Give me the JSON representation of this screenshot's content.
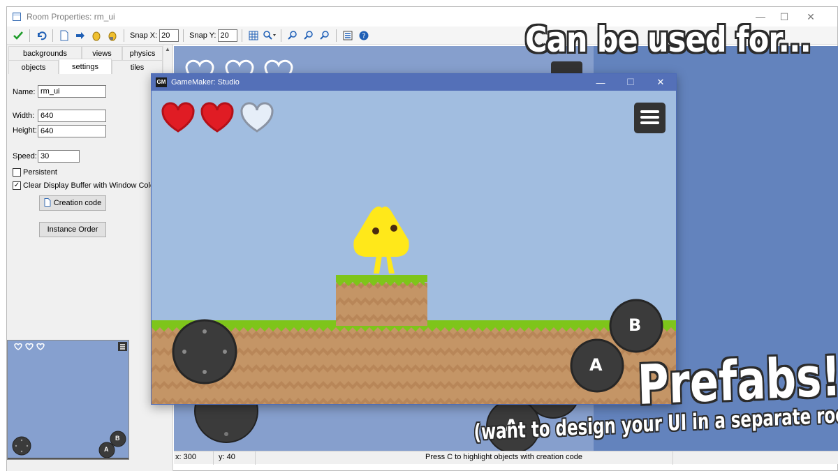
{
  "room_window": {
    "title": "Room Properties: rm_ui",
    "controls": {
      "minimize": "—",
      "maximize": "☐",
      "close": "✕"
    }
  },
  "toolbar": {
    "confirm_icon": "checkmark-icon",
    "undo_icon": "undo-icon",
    "snap_x_label": "Snap X:",
    "snap_x_value": "20",
    "snap_y_label": "Snap Y:",
    "snap_y_value": "20"
  },
  "tabs": {
    "backgrounds": "backgrounds",
    "views": "views",
    "physics": "physics",
    "objects": "objects",
    "settings": "settings",
    "tiles": "tiles"
  },
  "settings": {
    "name_label": "Name:",
    "name_value": "rm_ui",
    "width_label": "Width:",
    "width_value": "640",
    "height_label": "Height:",
    "height_value": "640",
    "speed_label": "Speed:",
    "speed_value": "30",
    "persistent_label": "Persistent",
    "persistent_checked": false,
    "clear_buffer_label": "Clear Display Buffer with Window Colour",
    "clear_buffer_checked": true,
    "creation_code_button": "Creation code",
    "instance_order_button": "Instance Order"
  },
  "mini_map": {
    "button_b": "B",
    "button_a": "A"
  },
  "room_canvas": {
    "button_a": "A"
  },
  "statusbar": {
    "x": "x: 300",
    "y": "y: 40",
    "message": "Press C to highlight objects with creation code"
  },
  "game_window": {
    "title": "GameMaker: Studio",
    "logo": "GM",
    "hearts_full": 2,
    "hearts_total": 3,
    "button_b": "B",
    "button_a": "A"
  },
  "overlay": {
    "headline": "Can be used for...",
    "prefabs": "Prefabs!",
    "subtitle": "(want to design your UI in a separate room?)"
  },
  "colors": {
    "game_sky": "#a1bde0",
    "grass": "#7ec51a",
    "dirt": "#c49566",
    "heart_red": "#e01c24",
    "player_yellow": "#ffe81a",
    "room_canvas": "#869fcd",
    "right_panel": "#6383bd",
    "titlebar": "#5470b8"
  }
}
